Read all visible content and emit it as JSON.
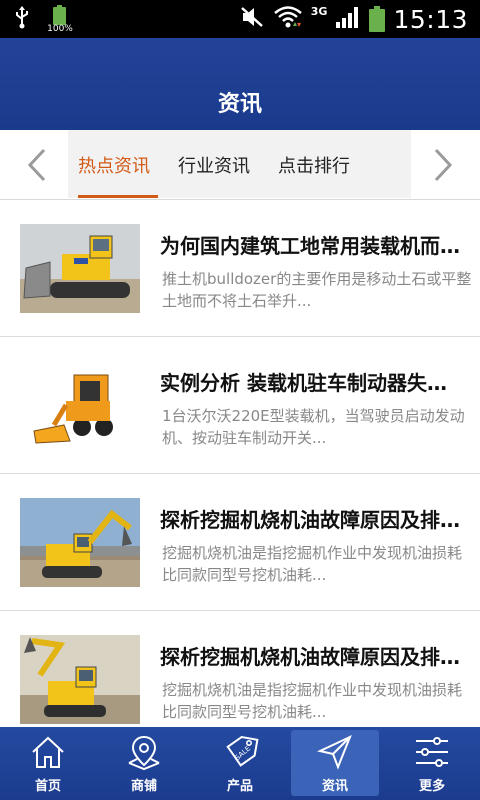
{
  "status_bar": {
    "battery_small_label": "100%",
    "network_label": "3G",
    "time": "15:13"
  },
  "header": {
    "title": "资讯"
  },
  "tabs": [
    {
      "label": "热点资讯",
      "active": true
    },
    {
      "label": "行业资讯",
      "active": false
    },
    {
      "label": "点击排行",
      "active": false
    }
  ],
  "articles": [
    {
      "title": "为何国内建筑工地常用装载机而非推土机",
      "desc": "推土机bulldozer的主要作用是移动土石或平整土地而不将土石举升...",
      "thumb_icon": "bulldozer-image"
    },
    {
      "title": "实例分析 装载机驻车制动器失效原因",
      "desc": "1台沃尔沃220E型装载机，当驾驶员启动发动机、按动驻车制动开关...",
      "thumb_icon": "skid-steer-loader-image"
    },
    {
      "title": "探析挖掘机烧机油故障原因及排除方法",
      "desc": "挖掘机烧机油是指挖掘机作业中发现机油损耗比同款同型号挖机油耗...",
      "thumb_icon": "excavator-image"
    },
    {
      "title": "探析挖掘机烧机油故障原因及排除方法",
      "desc": "挖掘机烧机油是指挖掘机作业中发现机油损耗比同款同型号挖机油耗...",
      "thumb_icon": "excavator-image"
    }
  ],
  "bottom_nav": [
    {
      "label": "首页",
      "icon": "home-icon"
    },
    {
      "label": "商铺",
      "icon": "map-pin-icon"
    },
    {
      "label": "产品",
      "icon": "sale-tag-icon"
    },
    {
      "label": "资讯",
      "icon": "paper-plane-icon",
      "active": true
    },
    {
      "label": "更多",
      "icon": "sliders-icon"
    }
  ],
  "colors": {
    "header_blue": "#1a3a8c",
    "active_tab": "#d35a16",
    "nav_active": "#3b63b7"
  }
}
